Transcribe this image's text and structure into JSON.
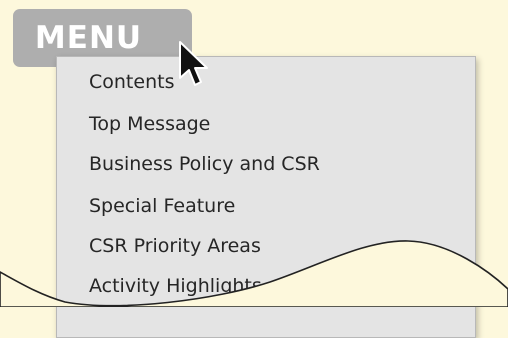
{
  "menu": {
    "label": "MENU"
  },
  "dropdown": {
    "items": [
      {
        "label": "Contents"
      },
      {
        "label": "Top Message"
      },
      {
        "label": "Business Policy and CSR"
      },
      {
        "label": "Special Feature"
      },
      {
        "label": "CSR Priority Areas"
      },
      {
        "label": "Activity Highlights"
      }
    ]
  },
  "colors": {
    "background": "#fdf8dc",
    "menu_button": "#aeaeae",
    "dropdown_bg": "#e4e4e4",
    "text": "#262626"
  }
}
